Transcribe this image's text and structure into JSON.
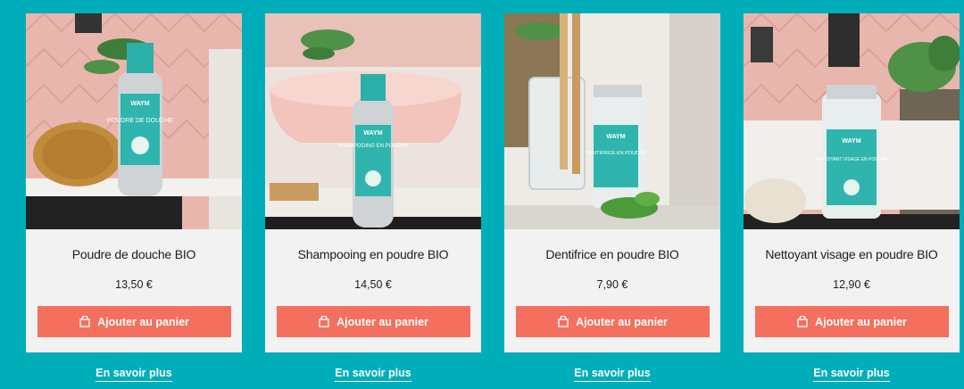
{
  "colors": {
    "page_bg": "#00aeb9",
    "card_bg": "#f2f2f2",
    "button_bg": "#f46f5e",
    "text": "#1e1e1e"
  },
  "products": [
    {
      "name": "Poudre de douche BIO",
      "price": "13,50 €",
      "cart_label": "Ajouter au panier",
      "more_label": "En savoir plus",
      "image_icon": "shower-powder-bottle-photo",
      "brand_mark": "WAYM",
      "label_text": "POUDRE DE DOUCHE"
    },
    {
      "name": "Shampooing en poudre BIO",
      "price": "14,50 €",
      "cart_label": "Ajouter au panier",
      "more_label": "En savoir plus",
      "image_icon": "shampoo-powder-bottle-photo",
      "brand_mark": "WAYM",
      "label_text": "SHAMPOOING EN POUDRE"
    },
    {
      "name": "Dentifrice en poudre BIO",
      "price": "7,90 €",
      "cart_label": "Ajouter au panier",
      "more_label": "En savoir plus",
      "image_icon": "toothpaste-powder-jar-photo",
      "brand_mark": "WAYM",
      "label_text": "DENTIFRICE EN POUDRE"
    },
    {
      "name": "Nettoyant visage en poudre BIO",
      "price": "12,90 €",
      "cart_label": "Ajouter au panier",
      "more_label": "En savoir plus",
      "image_icon": "face-cleanser-powder-jar-photo",
      "brand_mark": "WAYM",
      "label_text": "NETTOYANT VISAGE EN POUDRE"
    }
  ]
}
